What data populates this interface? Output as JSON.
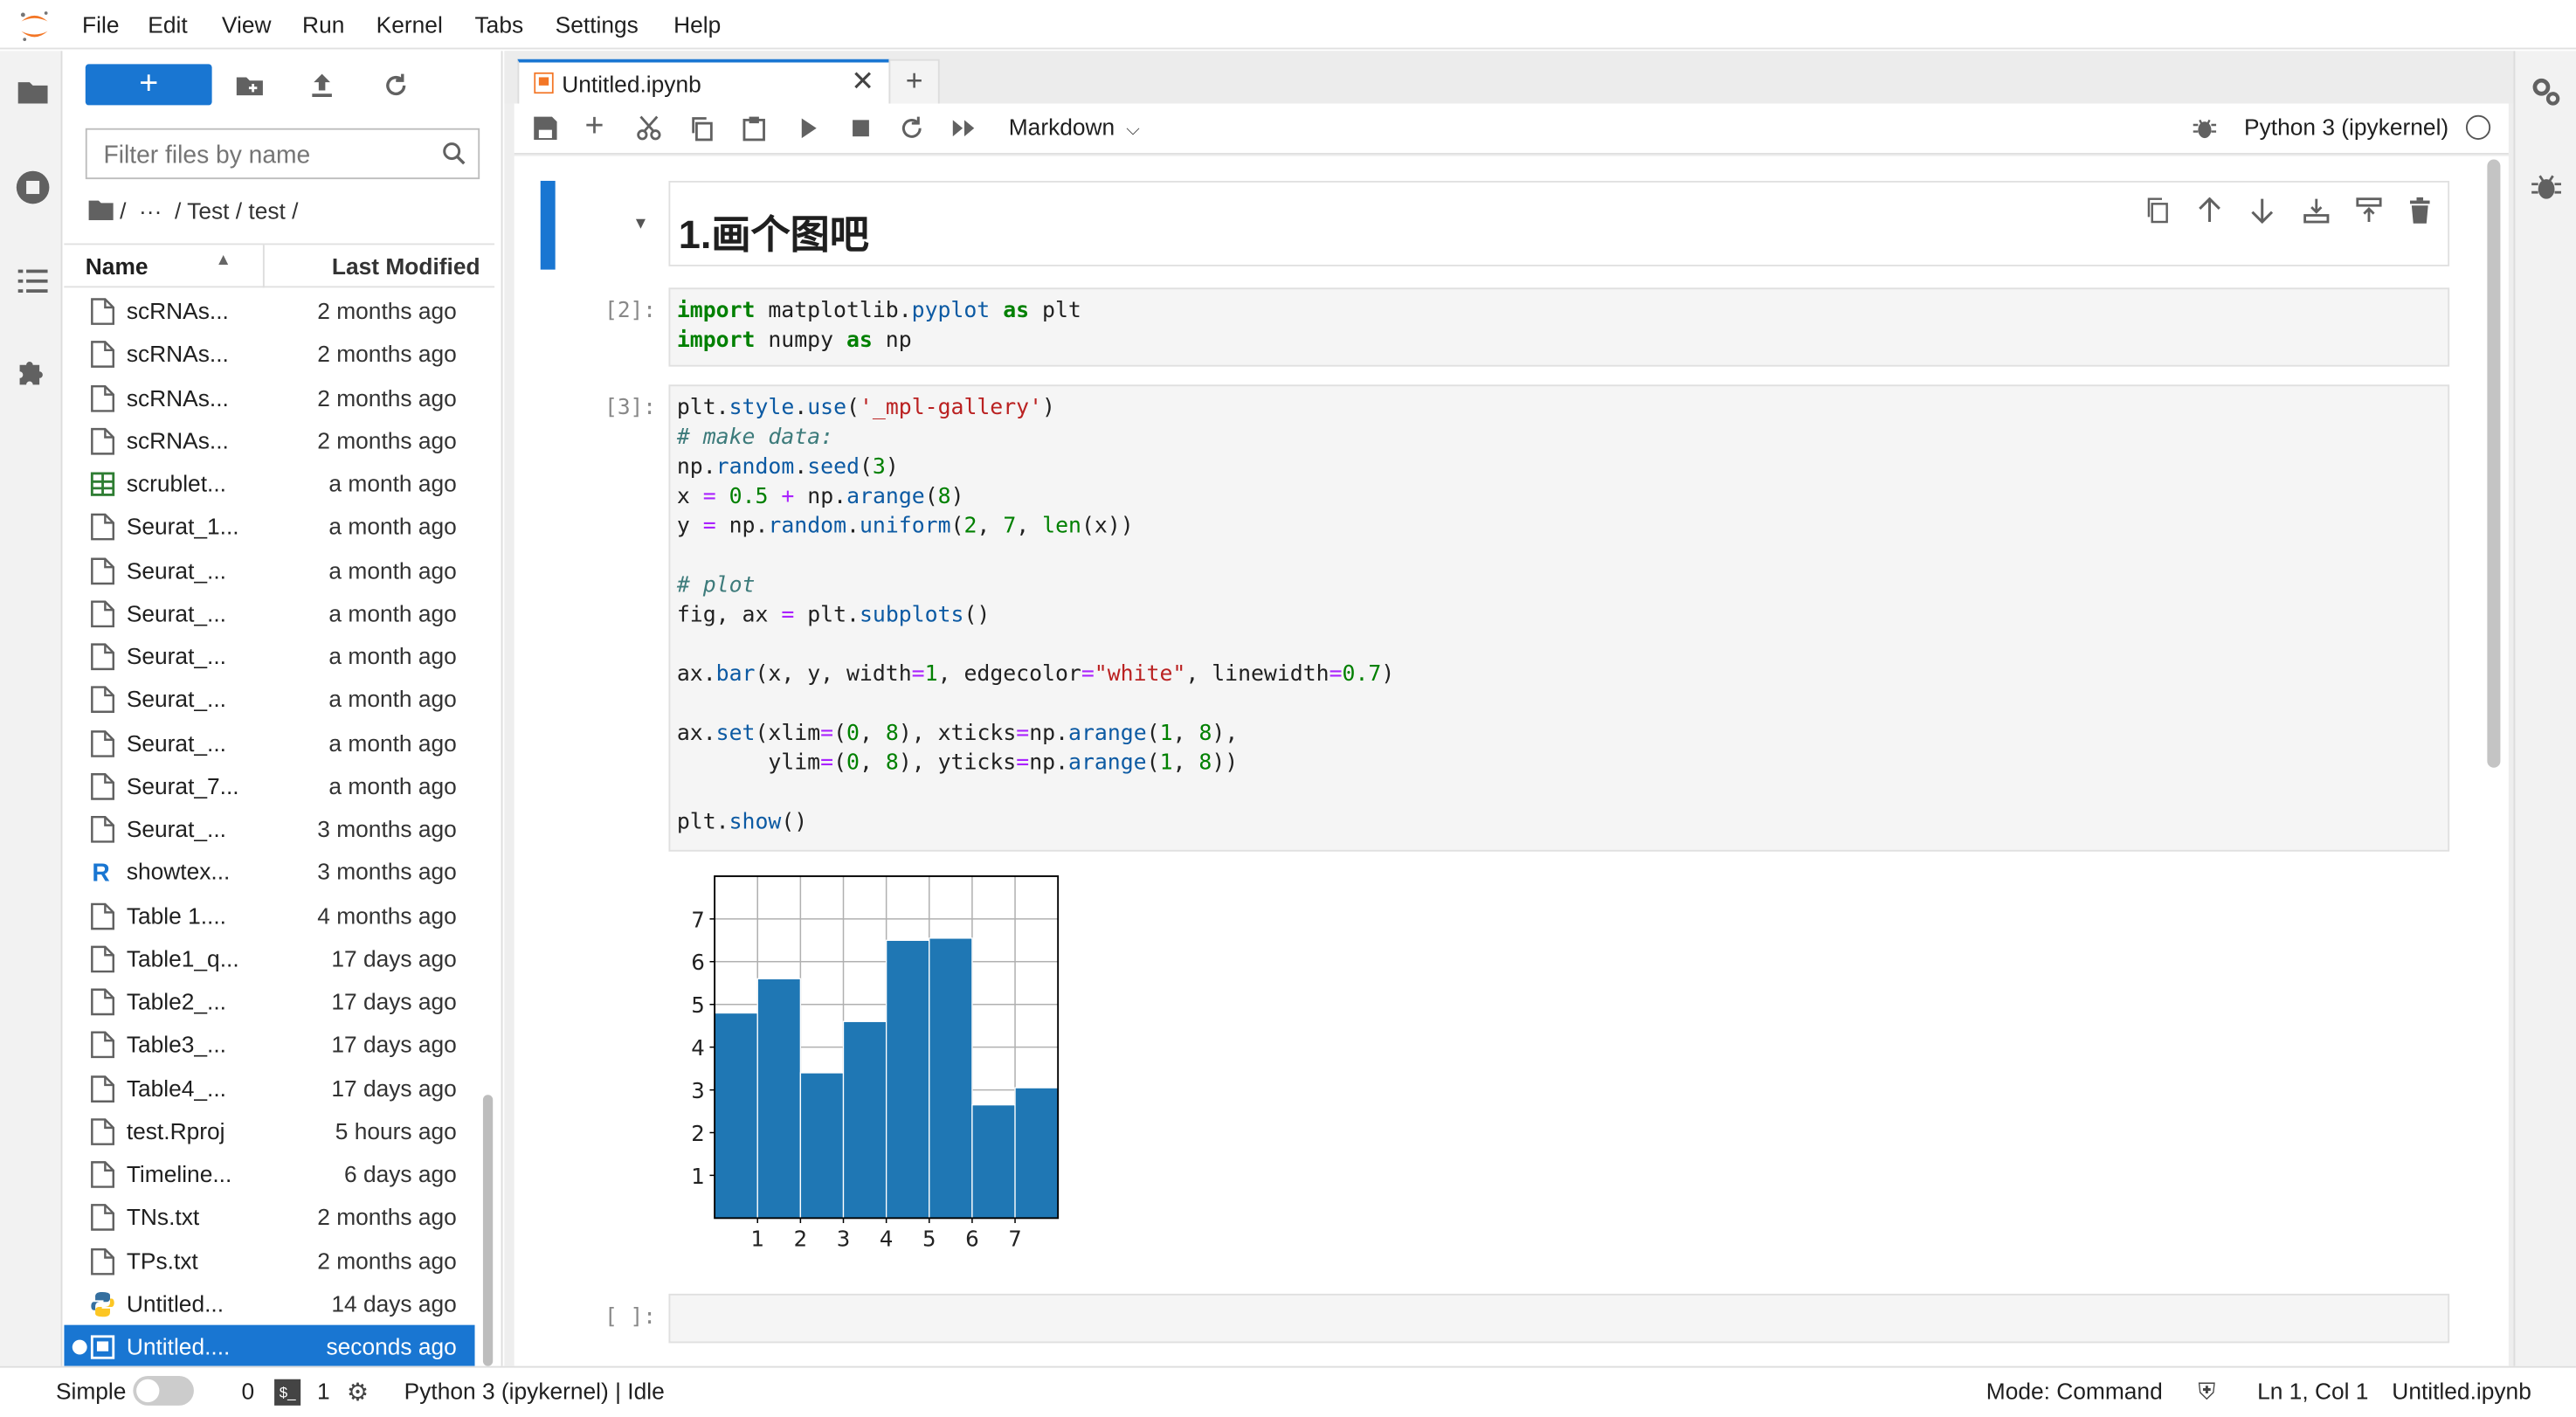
{
  "menubar": {
    "items": [
      "File",
      "Edit",
      "View",
      "Run",
      "Kernel",
      "Tabs",
      "Settings",
      "Help"
    ]
  },
  "filebrowser": {
    "new_label": "+",
    "filter_placeholder": "Filter files by name",
    "breadcrumb": {
      "root": "/",
      "ellipsis": "···",
      "path": "/ Test / test /"
    },
    "headers": {
      "name": "Name",
      "modified": "Last Modified"
    },
    "files": [
      {
        "name": "scRNAs...",
        "modified": "2 months ago",
        "icon": "file-icon"
      },
      {
        "name": "scRNAs...",
        "modified": "2 months ago",
        "icon": "file-icon"
      },
      {
        "name": "scRNAs...",
        "modified": "2 months ago",
        "icon": "file-icon"
      },
      {
        "name": "scRNAs...",
        "modified": "2 months ago",
        "icon": "file-icon"
      },
      {
        "name": "scrublet...",
        "modified": "a month ago",
        "icon": "spreadsheet-icon"
      },
      {
        "name": "Seurat_1...",
        "modified": "a month ago",
        "icon": "file-icon"
      },
      {
        "name": "Seurat_...",
        "modified": "a month ago",
        "icon": "file-icon"
      },
      {
        "name": "Seurat_...",
        "modified": "a month ago",
        "icon": "file-icon"
      },
      {
        "name": "Seurat_...",
        "modified": "a month ago",
        "icon": "file-icon"
      },
      {
        "name": "Seurat_...",
        "modified": "a month ago",
        "icon": "file-icon"
      },
      {
        "name": "Seurat_...",
        "modified": "a month ago",
        "icon": "file-icon"
      },
      {
        "name": "Seurat_7...",
        "modified": "a month ago",
        "icon": "file-icon"
      },
      {
        "name": "Seurat_...",
        "modified": "3 months ago",
        "icon": "file-icon"
      },
      {
        "name": "showtex...",
        "modified": "3 months ago",
        "icon": "r-icon"
      },
      {
        "name": "Table 1....",
        "modified": "4 months ago",
        "icon": "file-icon"
      },
      {
        "name": "Table1_q...",
        "modified": "17 days ago",
        "icon": "file-icon"
      },
      {
        "name": "Table2_...",
        "modified": "17 days ago",
        "icon": "file-icon"
      },
      {
        "name": "Table3_...",
        "modified": "17 days ago",
        "icon": "file-icon"
      },
      {
        "name": "Table4_...",
        "modified": "17 days ago",
        "icon": "file-icon"
      },
      {
        "name": "test.Rproj",
        "modified": "5 hours ago",
        "icon": "file-icon"
      },
      {
        "name": "Timeline...",
        "modified": "6 days ago",
        "icon": "file-icon"
      },
      {
        "name": "TNs.txt",
        "modified": "2 months ago",
        "icon": "file-icon"
      },
      {
        "name": "TPs.txt",
        "modified": "2 months ago",
        "icon": "file-icon"
      },
      {
        "name": "Untitled...",
        "modified": "14 days ago",
        "icon": "python-icon"
      },
      {
        "name": "Untitled....",
        "modified": "seconds ago",
        "icon": "notebook-icon",
        "selected": true
      }
    ]
  },
  "tab": {
    "title": "Untitled.ipynb"
  },
  "toolbar": {
    "cell_type": "Markdown",
    "kernel": "Python 3 (ipykernel)"
  },
  "cells": {
    "markdown_heading": "1.画个图吧",
    "prompt2": "[2]:",
    "prompt3": "[3]:",
    "prompt_empty": "[ ]:"
  },
  "chart_data": {
    "type": "bar",
    "x": [
      0.5,
      1.5,
      2.5,
      3.5,
      4.5,
      5.5,
      6.5,
      7.5
    ],
    "values": [
      4.8,
      5.6,
      3.4,
      4.6,
      6.5,
      6.55,
      2.65,
      3.05
    ],
    "xlim": [
      0,
      8
    ],
    "ylim": [
      0,
      8
    ],
    "xticks": [
      "1",
      "2",
      "3",
      "4",
      "5",
      "6",
      "7"
    ],
    "yticks": [
      "1",
      "2",
      "3",
      "4",
      "5",
      "6",
      "7"
    ],
    "bar_color": "#1f77b4",
    "edge_color": "#ffffff",
    "grid": true
  },
  "status": {
    "mode_label": "Simple",
    "count0": "0",
    "count1": "1",
    "kernel_status": "Python 3 (ipykernel) | Idle",
    "mode": "Mode: Command",
    "position": "Ln 1, Col 1",
    "file": "Untitled.ipynb"
  },
  "colors": {
    "accent": "#1976d2",
    "orange": "#f37626"
  }
}
